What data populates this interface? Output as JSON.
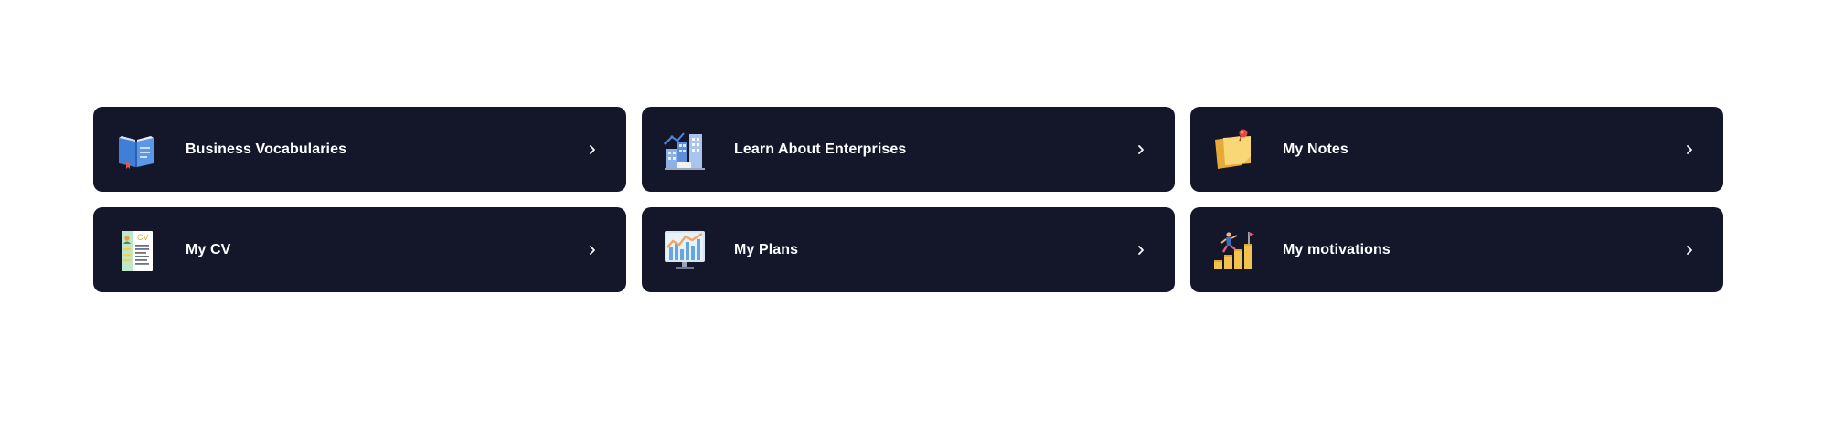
{
  "cards": [
    {
      "label": "Business Vocabularies",
      "icon": "book-icon"
    },
    {
      "label": "Learn About Enterprises",
      "icon": "enterprise-buildings-icon"
    },
    {
      "label": "My Notes",
      "icon": "sticky-note-icon"
    },
    {
      "label": "My CV",
      "icon": "cv-document-icon"
    },
    {
      "label": "My Plans",
      "icon": "growth-chart-monitor-icon"
    },
    {
      "label": "My motivations",
      "icon": "climbing-goal-icon"
    }
  ],
  "colors": {
    "page_background": "#ffffff",
    "card_background": "#131729",
    "text": "#ffffff"
  },
  "cv_icon_text": "CV"
}
